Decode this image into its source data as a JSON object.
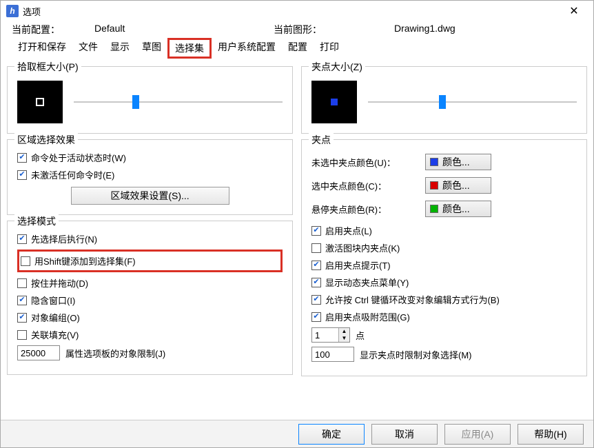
{
  "window": {
    "title": "选项"
  },
  "config": {
    "current_label": "当前配置：",
    "current_value": "Default",
    "drawing_label": "当前图形：",
    "drawing_value": "Drawing1.dwg"
  },
  "tabs": {
    "t0": "打开和保存",
    "t1": "文件",
    "t2": "显示",
    "t3": "草图",
    "t4": "选择集",
    "t5": "用户系统配置",
    "t6": "配置",
    "t7": "打印"
  },
  "left": {
    "pickbox_label": "拾取框大小(P)",
    "area_label": "区域选择效果",
    "area_active": "命令处于活动状态时(W)",
    "area_inactive": "未激活任何命令时(E)",
    "area_settings_btn": "区域效果设置(S)...",
    "mode_label": "选择模式",
    "mode_noun": "先选择后执行(N)",
    "mode_shift": "用Shift键添加到选择集(F)",
    "mode_drag": "按住并拖动(D)",
    "mode_implied": "隐含窗口(I)",
    "mode_group": "对象编组(O)",
    "mode_hatch": "关联填充(V)",
    "prop_limit_value": "25000",
    "prop_limit_label": "属性选项板的对象限制(J)"
  },
  "right": {
    "grip_label": "夹点大小(Z)",
    "grips_section": "夹点",
    "unsel_color_label": "未选中夹点颜色(U)：",
    "sel_color_label": "选中夹点颜色(C)：",
    "hover_color_label": "悬停夹点颜色(R)：",
    "color_btn": "颜色...",
    "colors": {
      "unsel": "#1c3ee8",
      "sel": "#d90000",
      "hover": "#00b300"
    },
    "enable_grips": "启用夹点(L)",
    "block_grips": "激活图块内夹点(K)",
    "grip_tips": "启用夹点提示(T)",
    "dyn_menu": "显示动态夹点菜单(Y)",
    "ctrl_cycle": "允许按 Ctrl 键循环改变对象编辑方式行为(B)",
    "snap_range": "启用夹点吸附范围(G)",
    "snap_px_value": "1",
    "snap_px_label": "点",
    "grip_limit_value": "100",
    "grip_limit_label": "显示夹点时限制对象选择(M)"
  },
  "footer": {
    "ok": "确定",
    "cancel": "取消",
    "apply": "应用(A)",
    "help": "帮助(H)"
  }
}
